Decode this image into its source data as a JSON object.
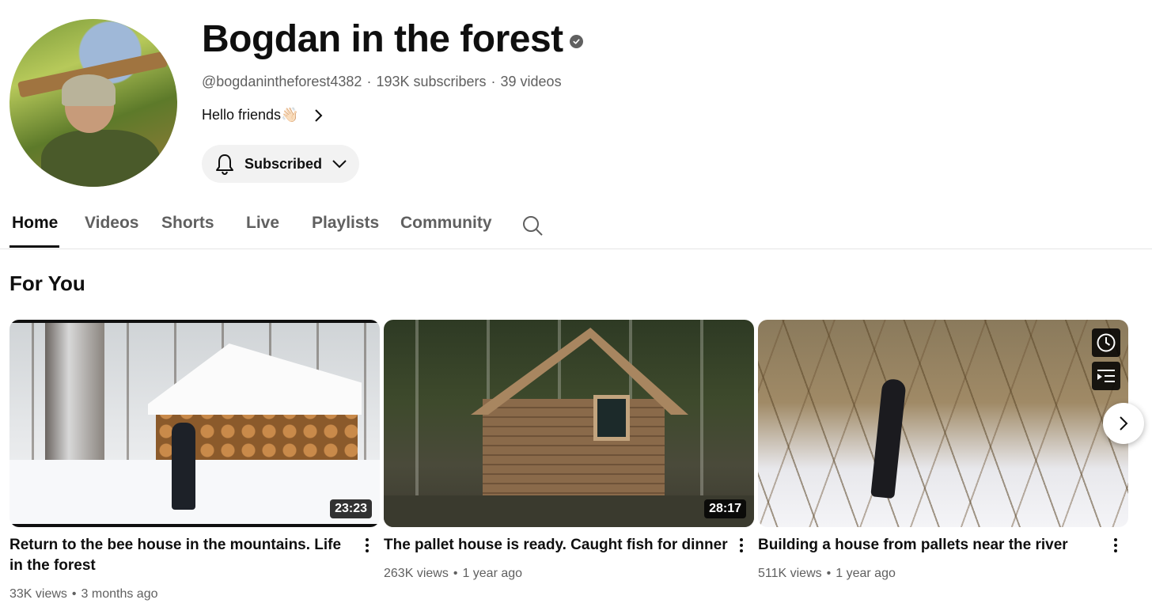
{
  "channel": {
    "name": "Bogdan in the forest",
    "handle": "@bogdanintheforest4382",
    "subscribers": "193K subscribers",
    "videos_count": "39 videos",
    "description": "Hello friends👋🏻",
    "subscribe_label": "Subscribed"
  },
  "tabs": [
    {
      "label": "Home",
      "active": true
    },
    {
      "label": "Videos"
    },
    {
      "label": "Shorts"
    },
    {
      "label": "Live"
    },
    {
      "label": "Playlists"
    },
    {
      "label": "Community"
    }
  ],
  "section": {
    "title": "For You"
  },
  "videos": [
    {
      "title": "Return to the bee house in the mountains. Life in the forest",
      "views": "33K views",
      "age": "3 months ago",
      "duration": "23:23"
    },
    {
      "title": "The pallet house is ready. Caught fish for dinner",
      "views": "263K views",
      "age": "1 year ago",
      "duration": "28:17"
    },
    {
      "title": "Building a house from pallets near the river",
      "views": "511K views",
      "age": "1 year ago",
      "duration": ""
    }
  ],
  "meta_separator": "·",
  "video_meta_separator": "•",
  "colors": {
    "text_primary": "#0f0f0f",
    "text_secondary": "#606060",
    "chip_bg": "#f2f2f2"
  }
}
